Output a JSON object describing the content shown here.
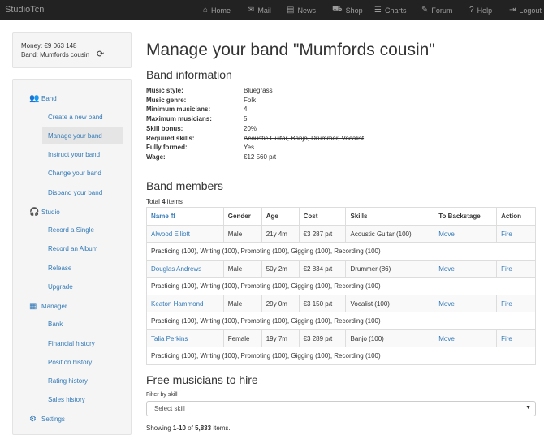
{
  "navbar": {
    "brand": "StudioTcn",
    "items": [
      {
        "label": "Home",
        "icon": "home-icon"
      },
      {
        "label": "Mail",
        "icon": "mail-icon"
      },
      {
        "label": "News",
        "icon": "news-icon"
      },
      {
        "label": "Shop",
        "icon": "cart-icon"
      },
      {
        "label": "Charts",
        "icon": "list-icon"
      },
      {
        "label": "Forum",
        "icon": "comments-icon"
      },
      {
        "label": "Help",
        "icon": "help-icon"
      },
      {
        "label": "Logout",
        "icon": "logout-icon"
      }
    ]
  },
  "sidebar": {
    "money": "Money: €9 063 148",
    "band": "Band: Mumfords cousin",
    "sections": [
      {
        "label": "Band",
        "icon": "users-icon",
        "items": [
          "Create a new band",
          "Manage your band",
          "Instruct your band",
          "Change your band",
          "Disband your band"
        ]
      },
      {
        "label": "Studio",
        "icon": "headphones-icon",
        "items": [
          "Record a Single",
          "Record an Album",
          "Release",
          "Upgrade"
        ]
      },
      {
        "label": "Manager",
        "icon": "calculator-icon",
        "items": [
          "Bank",
          "Financial history",
          "Position history",
          "Rating history",
          "Sales history"
        ]
      },
      {
        "label": "Settings",
        "icon": "gear-icon",
        "items": []
      }
    ],
    "active_item": "Manage your band"
  },
  "main": {
    "title": "Manage your band \"Mumfords cousin\"",
    "info_heading": "Band information",
    "info": [
      {
        "label": "Music style:",
        "value": "Bluegrass"
      },
      {
        "label": "Music genre:",
        "value": "Folk"
      },
      {
        "label": "Minimum musicians:",
        "value": "4"
      },
      {
        "label": "Maximum musicians:",
        "value": "5"
      },
      {
        "label": "Skill bonus:",
        "value": "20%"
      },
      {
        "label": "Required skills:",
        "value": "Acoustic Guitar, Banjo, Drummer, Vocalist"
      },
      {
        "label": "Fully formed:",
        "value": "Yes"
      },
      {
        "label": "Wage:",
        "value": "€12 560 p/t"
      }
    ],
    "members_heading": "Band members",
    "total_prefix": "Total ",
    "total_count": "4",
    "total_suffix": " items",
    "columns": [
      "Name",
      "Gender",
      "Age",
      "Cost",
      "Skills",
      "To Backstage",
      "Action"
    ],
    "members": [
      {
        "name": "Alwood Elliott",
        "gender": "Male",
        "age": "21y 4m",
        "cost": "€3 287 p/t",
        "skill": "Acoustic Guitar (100)",
        "backstage": "Move",
        "action": "Fire",
        "skills_line": "Practicing (100), Writing (100), Promoting (100), Gigging (100), Recording (100)"
      },
      {
        "name": "Douglas Andrews",
        "gender": "Male",
        "age": "50y 2m",
        "cost": "€2 834 p/t",
        "skill": "Drummer (86)",
        "backstage": "Move",
        "action": "Fire",
        "skills_line": "Practicing (100), Writing (100), Promoting (100), Gigging (100), Recording (100)"
      },
      {
        "name": "Keaton Hammond",
        "gender": "Male",
        "age": "29y 0m",
        "cost": "€3 150 p/t",
        "skill": "Vocalist (100)",
        "backstage": "Move",
        "action": "Fire",
        "skills_line": "Practicing (100), Writing (100), Promoting (100), Gigging (100), Recording (100)"
      },
      {
        "name": "Talia Perkins",
        "gender": "Female",
        "age": "19y 7m",
        "cost": "€3 289 p/t",
        "skill": "Banjo (100)",
        "backstage": "Move",
        "action": "Fire",
        "skills_line": "Practicing (100), Writing (100), Promoting (100), Gigging (100), Recording (100)"
      }
    ],
    "hire_heading": "Free musicians to hire",
    "filter_label": "Filter by skill",
    "select_placeholder": "Select skill",
    "showing_prefix": "Showing ",
    "showing_range": "1-10",
    "showing_of": " of ",
    "showing_total": "5,833",
    "showing_suffix": " items."
  }
}
